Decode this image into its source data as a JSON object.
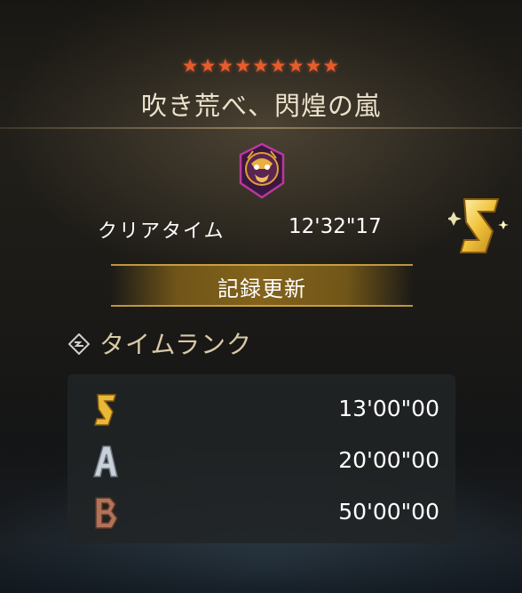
{
  "quest": {
    "stars": "★★★★★★★★★",
    "title": "吹き荒べ、閃煌の嵐"
  },
  "result": {
    "clear_label": "クリアタイム",
    "clear_time": "12'32\"17",
    "rank": "S",
    "record_label": "記録更新"
  },
  "time_rank": {
    "header": "タイムランク",
    "rows": [
      {
        "rank": "S",
        "time": "13'00\"00"
      },
      {
        "rank": "A",
        "time": "20'00\"00"
      },
      {
        "rank": "B",
        "time": "50'00\"00"
      }
    ]
  },
  "colors": {
    "star": "#e85c2c",
    "gold": "#d7aa46",
    "silver": "#c8d0d8",
    "bronze": "#b0735a"
  },
  "icons": {
    "emblem": "monster-emblem-icon",
    "rank_header": "time-rank-icon"
  }
}
